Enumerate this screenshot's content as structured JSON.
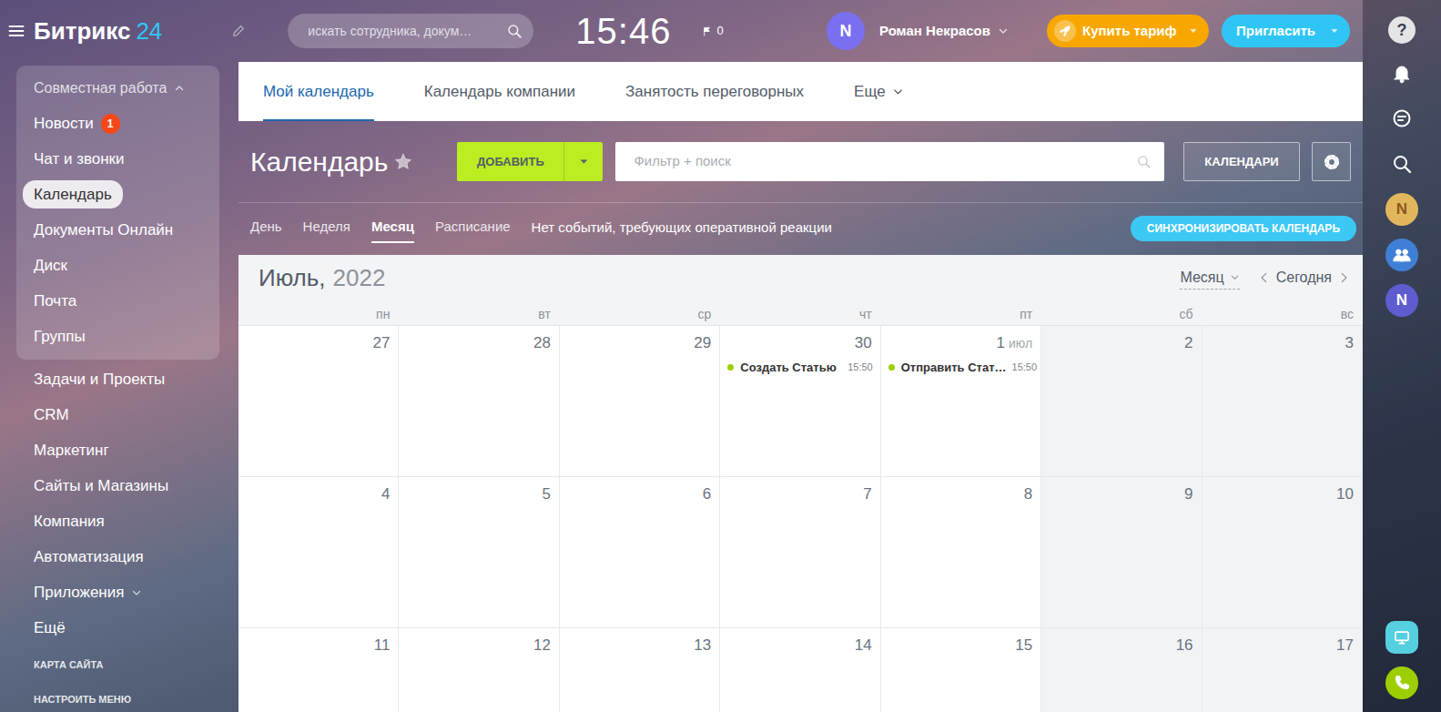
{
  "header": {
    "logo": {
      "name": "Битрикс",
      "number": "24"
    },
    "search": {
      "placeholder": "искать сотрудника, докум…"
    },
    "clock": "15:46",
    "flag_count": "0",
    "user": {
      "initial": "N",
      "name": "Роман Некрасов",
      "color": "#7a6ff0"
    },
    "buy_button": "Купить тариф",
    "invite_button": "Пригласить"
  },
  "sidebar": {
    "group": {
      "label": "Совместная работа",
      "expanded": true,
      "items": [
        {
          "label": "Новости",
          "badge": "1",
          "selected": false
        },
        {
          "label": "Чат и звонки",
          "selected": false
        },
        {
          "label": "Календарь",
          "selected": true
        },
        {
          "label": "Документы Онлайн",
          "selected": false
        },
        {
          "label": "Диск",
          "selected": false
        },
        {
          "label": "Почта",
          "selected": false
        },
        {
          "label": "Группы",
          "selected": false
        }
      ]
    },
    "items": [
      {
        "label": "Задачи и Проекты",
        "selected": false,
        "expandable": false
      },
      {
        "label": "CRM",
        "selected": false,
        "expandable": false
      },
      {
        "label": "Маркетинг",
        "selected": false,
        "expandable": false
      },
      {
        "label": "Сайты и Магазины",
        "selected": false,
        "expandable": false
      },
      {
        "label": "Компания",
        "selected": false,
        "expandable": false
      },
      {
        "label": "Автоматизация",
        "selected": false,
        "expandable": false
      },
      {
        "label": "Приложения",
        "selected": false,
        "expandable": true
      },
      {
        "label": "Ещё",
        "selected": false,
        "expandable": false
      }
    ],
    "footer": [
      "КАРТА САЙТА",
      "НАСТРОИТЬ МЕНЮ"
    ]
  },
  "tabs": [
    {
      "label": "Мой календарь",
      "selected": true,
      "dropdown": false
    },
    {
      "label": "Календарь компании",
      "selected": false,
      "dropdown": false
    },
    {
      "label": "Занятость переговорных",
      "selected": false,
      "dropdown": false
    },
    {
      "label": "Еще",
      "selected": false,
      "dropdown": true
    }
  ],
  "toolbar": {
    "title": "Календарь",
    "add_button": "ДОБАВИТЬ",
    "filter": {
      "placeholder": "Фильтр + поиск"
    },
    "calendars_button": "КАЛЕНДАРИ"
  },
  "views": [
    {
      "label": "День",
      "selected": false
    },
    {
      "label": "Неделя",
      "selected": false
    },
    {
      "label": "Месяц",
      "selected": true
    },
    {
      "label": "Расписание",
      "selected": false
    }
  ],
  "notice": "Нет событий, требующих оперативной реакции",
  "sync_button": "СИНХРОНИЗИРОВАТЬ КАЛЕНДАРЬ",
  "calendar": {
    "month": "Июль,",
    "year": "2022",
    "view_select": "Месяц",
    "today": "Сегодня",
    "weekdays": [
      "пн",
      "вт",
      "ср",
      "чт",
      "пт",
      "сб",
      "вс"
    ],
    "weeks": [
      [
        {
          "day": "27",
          "weekend": false
        },
        {
          "day": "28",
          "weekend": false
        },
        {
          "day": "29",
          "weekend": false
        },
        {
          "day": "30",
          "weekend": false,
          "events": [
            {
              "title": "Создать Статью",
              "time": "15:50",
              "color": "#9dcf00"
            }
          ]
        },
        {
          "day": "1",
          "month_label": "июл",
          "weekend": false,
          "events": [
            {
              "title": "Отправить Стат…",
              "time": "15:50",
              "color": "#9dcf00"
            }
          ]
        },
        {
          "day": "2",
          "weekend": true
        },
        {
          "day": "3",
          "weekend": true
        }
      ],
      [
        {
          "day": "4",
          "weekend": false
        },
        {
          "day": "5",
          "weekend": false
        },
        {
          "day": "6",
          "weekend": false
        },
        {
          "day": "7",
          "weekend": false
        },
        {
          "day": "8",
          "weekend": false
        },
        {
          "day": "9",
          "weekend": true
        },
        {
          "day": "10",
          "weekend": true
        }
      ],
      [
        {
          "day": "11",
          "weekend": false
        },
        {
          "day": "12",
          "weekend": false
        },
        {
          "day": "13",
          "weekend": false
        },
        {
          "day": "14",
          "weekend": false
        },
        {
          "day": "15",
          "weekend": false
        },
        {
          "day": "16",
          "weekend": true
        },
        {
          "day": "17",
          "weekend": true
        }
      ]
    ]
  },
  "right_rail": {
    "help": "?",
    "avatars": [
      {
        "initial": "N",
        "color": "#e2b65c",
        "text_color": "#8a5a1a"
      },
      {
        "initial": "N",
        "color": "#5e5ccf",
        "text_color": "#ffffff"
      }
    ]
  }
}
